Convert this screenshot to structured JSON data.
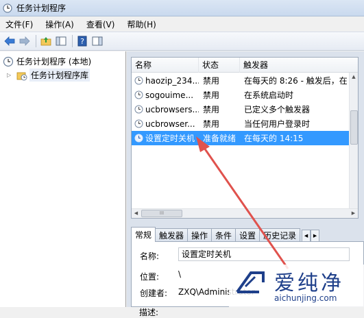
{
  "window": {
    "title": "任务计划程序"
  },
  "menu": [
    "文件(F)",
    "操作(A)",
    "查看(V)",
    "帮助(H)"
  ],
  "tree": {
    "root": "任务计划程序 (本地)",
    "child": "任务计划程序库"
  },
  "list": {
    "headers": {
      "name": "名称",
      "state": "状态",
      "trigger": "触发器"
    },
    "rows": [
      {
        "name": "haozip_234...",
        "state": "禁用",
        "trigger": "在每天的 8:26 - 触发后，在"
      },
      {
        "name": "sogouime...",
        "state": "禁用",
        "trigger": "在系统启动时"
      },
      {
        "name": "ucbrowsers...",
        "state": "禁用",
        "trigger": "已定义多个触发器"
      },
      {
        "name": "ucbrowser...",
        "state": "禁用",
        "trigger": "当任何用户登录时"
      },
      {
        "name": "设置定时关机",
        "state": "准备就绪",
        "trigger": "在每天的 14:15"
      }
    ],
    "hscroll_label": "III"
  },
  "tabs": [
    "常规",
    "触发器",
    "操作",
    "条件",
    "设置",
    "历史记录"
  ],
  "details": {
    "name_label": "名称:",
    "name_value": "设置定时关机",
    "location_label": "位置:",
    "location_value": "\\",
    "author_label": "创建者:",
    "author_value": "ZXQ\\Administrator",
    "desc_label": "描述:"
  },
  "watermark": {
    "cn": "爱纯净",
    "url": "aichunjing.com"
  },
  "colors": {
    "selection": "#3399ff",
    "arrow": "#e0524d",
    "watermark": "#1e3f8a"
  }
}
